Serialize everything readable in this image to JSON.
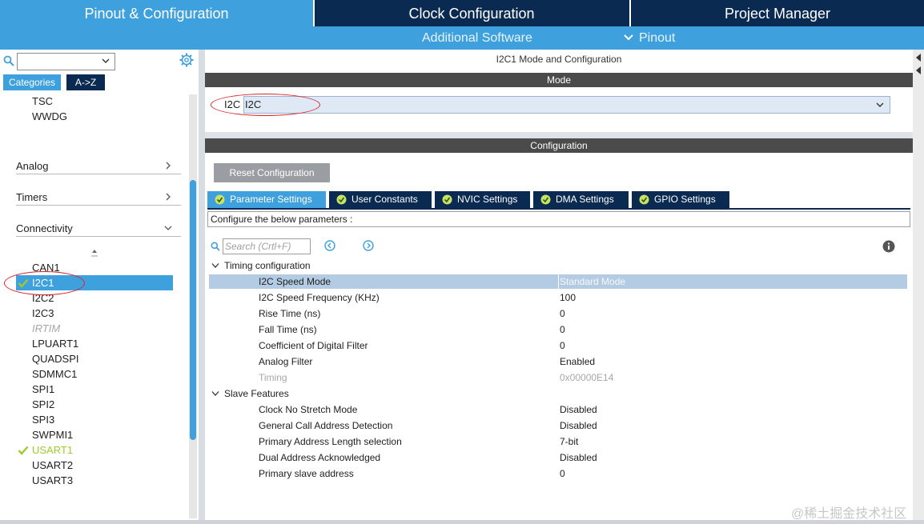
{
  "header": {
    "tabs": [
      {
        "label": "Pinout & Configuration",
        "active": true
      },
      {
        "label": "Clock Configuration",
        "active": false
      },
      {
        "label": "Project Manager",
        "active": false
      }
    ],
    "sub": {
      "additional_software": "Additional Software",
      "pinout": "Pinout"
    }
  },
  "left": {
    "tabs": {
      "categories": "Categories",
      "az": "A->Z"
    },
    "top_items": [
      "TSC",
      "WWDG"
    ],
    "categories": [
      {
        "label": "Analog",
        "icon": "chevron-right-icon"
      },
      {
        "label": "Timers",
        "icon": "chevron-right-icon"
      },
      {
        "label": "Connectivity",
        "icon": "chevron-down-icon"
      }
    ],
    "items": [
      {
        "label": "CAN1",
        "state": "normal"
      },
      {
        "label": "I2C1",
        "state": "selected"
      },
      {
        "label": "I2C2",
        "state": "normal"
      },
      {
        "label": "I2C3",
        "state": "normal"
      },
      {
        "label": "IRTIM",
        "state": "disabled"
      },
      {
        "label": "LPUART1",
        "state": "normal"
      },
      {
        "label": "QUADSPI",
        "state": "normal"
      },
      {
        "label": "SDMMC1",
        "state": "normal"
      },
      {
        "label": "SPI1",
        "state": "normal"
      },
      {
        "label": "SPI2",
        "state": "normal"
      },
      {
        "label": "SPI3",
        "state": "normal"
      },
      {
        "label": "SWPMI1",
        "state": "normal"
      },
      {
        "label": "USART1",
        "state": "configured"
      },
      {
        "label": "USART2",
        "state": "normal"
      },
      {
        "label": "USART3",
        "state": "normal"
      }
    ]
  },
  "main": {
    "title": "I2C1 Mode and Configuration",
    "mode_header": "Mode",
    "mode_label": "I2C",
    "mode_value": "I2C",
    "config_header": "Configuration",
    "reset_button": "Reset Configuration",
    "param_tabs": [
      "Parameter Settings",
      "User Constants",
      "NVIC Settings",
      "DMA Settings",
      "GPIO Settings"
    ],
    "configure_text": "Configure the below parameters :",
    "search_placeholder": "Search (Crtl+F)",
    "groups": [
      {
        "title": "Timing configuration",
        "params": [
          {
            "name": "I2C Speed Mode",
            "value": "Standard Mode",
            "state": "highlight"
          },
          {
            "name": "I2C Speed Frequency (KHz)",
            "value": "100",
            "state": "normal"
          },
          {
            "name": "Rise Time (ns)",
            "value": "0",
            "state": "normal"
          },
          {
            "name": "Fall Time (ns)",
            "value": "0",
            "state": "normal"
          },
          {
            "name": "Coefficient of Digital Filter",
            "value": "0",
            "state": "normal"
          },
          {
            "name": "Analog Filter",
            "value": "Enabled",
            "state": "normal"
          },
          {
            "name": "Timing",
            "value": "0x00000E14",
            "state": "disabled"
          }
        ]
      },
      {
        "title": "Slave Features",
        "params": [
          {
            "name": "Clock No Stretch Mode",
            "value": "Disabled",
            "state": "normal"
          },
          {
            "name": "General Call Address Detection",
            "value": "Disabled",
            "state": "normal"
          },
          {
            "name": "Primary Address Length selection",
            "value": "7-bit",
            "state": "normal"
          },
          {
            "name": "Dual Address Acknowledged",
            "value": "Disabled",
            "state": "normal"
          },
          {
            "name": "Primary slave address",
            "value": "0",
            "state": "normal"
          }
        ]
      }
    ]
  },
  "watermark": "@稀土掘金技术社区",
  "colors": {
    "navy": "#0a2a52",
    "accent": "#3ea0dc",
    "check_green": "#9ccc2a",
    "annotation_red": "#d9262c"
  }
}
